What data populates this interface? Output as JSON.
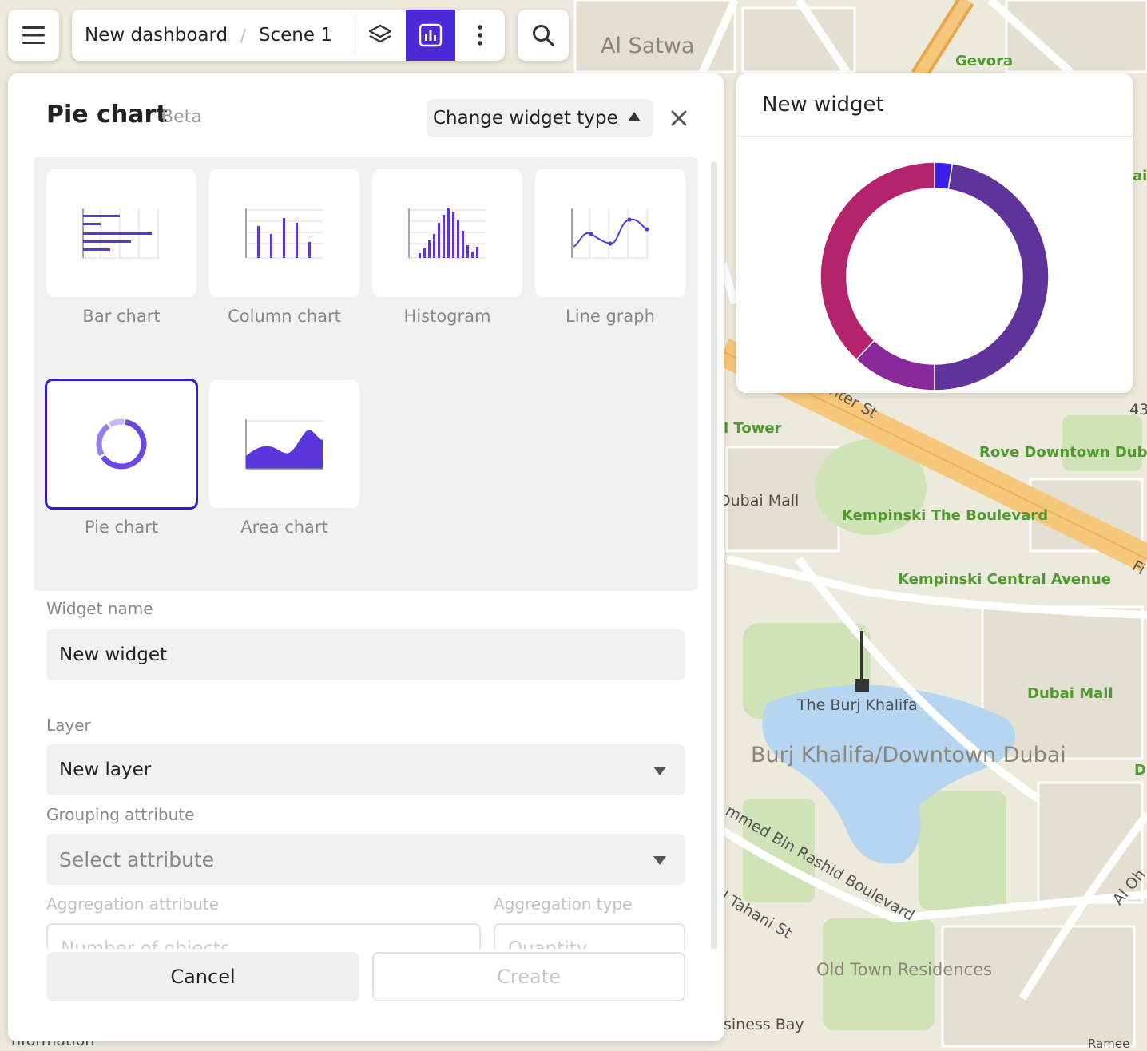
{
  "map": {
    "labels": {
      "al_satwa": "Al Satwa",
      "gevora": "Gevora",
      "tower": "l Tower",
      "center_st": "nter St",
      "dubai_mall_w": "Dubai Mall",
      "kempinski_blvd": "Kempinski The Boulevard",
      "kempinski_central": "Kempinski Central Avenue",
      "rove": "Rove Downtown Dubai",
      "burj_khalifa": "The Burj Khalifa",
      "dubai_mall": "Dubai Mall",
      "downtown": "Burj Khalifa/Downtown Dubai",
      "boulevard": "mmed Bin Rashid Boulevard",
      "tahani": "l Tahani St",
      "old_town": "Old Town Residences",
      "business_bay": "siness Bay",
      "information": "nformation",
      "number_43": "43",
      "ai": "ai",
      "fi": "Fi",
      "d": "D",
      "al_oh": "Al Oh",
      "ramee": "Ramee"
    }
  },
  "toolbar": {
    "breadcrumb": [
      "New dashboard",
      "Scene 1"
    ],
    "separator": "/",
    "icons": {
      "menu": "hamburger-menu-icon",
      "layers": "layers-icon",
      "widgets": "chart-widget-icon",
      "more": "more-vertical-icon",
      "search": "search-icon"
    },
    "active_color": "#4a2bd8"
  },
  "panel": {
    "title": "Pie chart",
    "badge": "Beta",
    "change_type_label": "Change widget type",
    "types": [
      {
        "label": "Bar chart",
        "icon": "bar-chart-icon"
      },
      {
        "label": "Column chart",
        "icon": "column-chart-icon"
      },
      {
        "label": "Histogram",
        "icon": "histogram-icon"
      },
      {
        "label": "Line graph",
        "icon": "line-graph-icon"
      },
      {
        "label": "Pie chart",
        "icon": "pie-chart-icon",
        "selected": true
      },
      {
        "label": "Area chart",
        "icon": "area-chart-icon"
      }
    ],
    "widget_name_label": "Widget name",
    "widget_name_value": "New widget",
    "layer_label": "Layer",
    "layer_value": "New layer",
    "grouping_label": "Grouping attribute",
    "grouping_placeholder": "Select attribute",
    "aggregation_attr_label": "Aggregation attribute",
    "aggregation_attr_value": "Number of objects",
    "aggregation_type_label": "Aggregation type",
    "aggregation_type_value": "Quantity",
    "cancel_label": "Cancel",
    "create_label": "Create",
    "accent_color": "#3a18c9"
  },
  "widget": {
    "title": "New widget"
  },
  "chart_data": {
    "type": "pie",
    "values": [
      2.5,
      47.5,
      12,
      38
    ],
    "colors": [
      "#3a1ee8",
      "#60339a",
      "#8a2a9a",
      "#b3246c"
    ]
  }
}
